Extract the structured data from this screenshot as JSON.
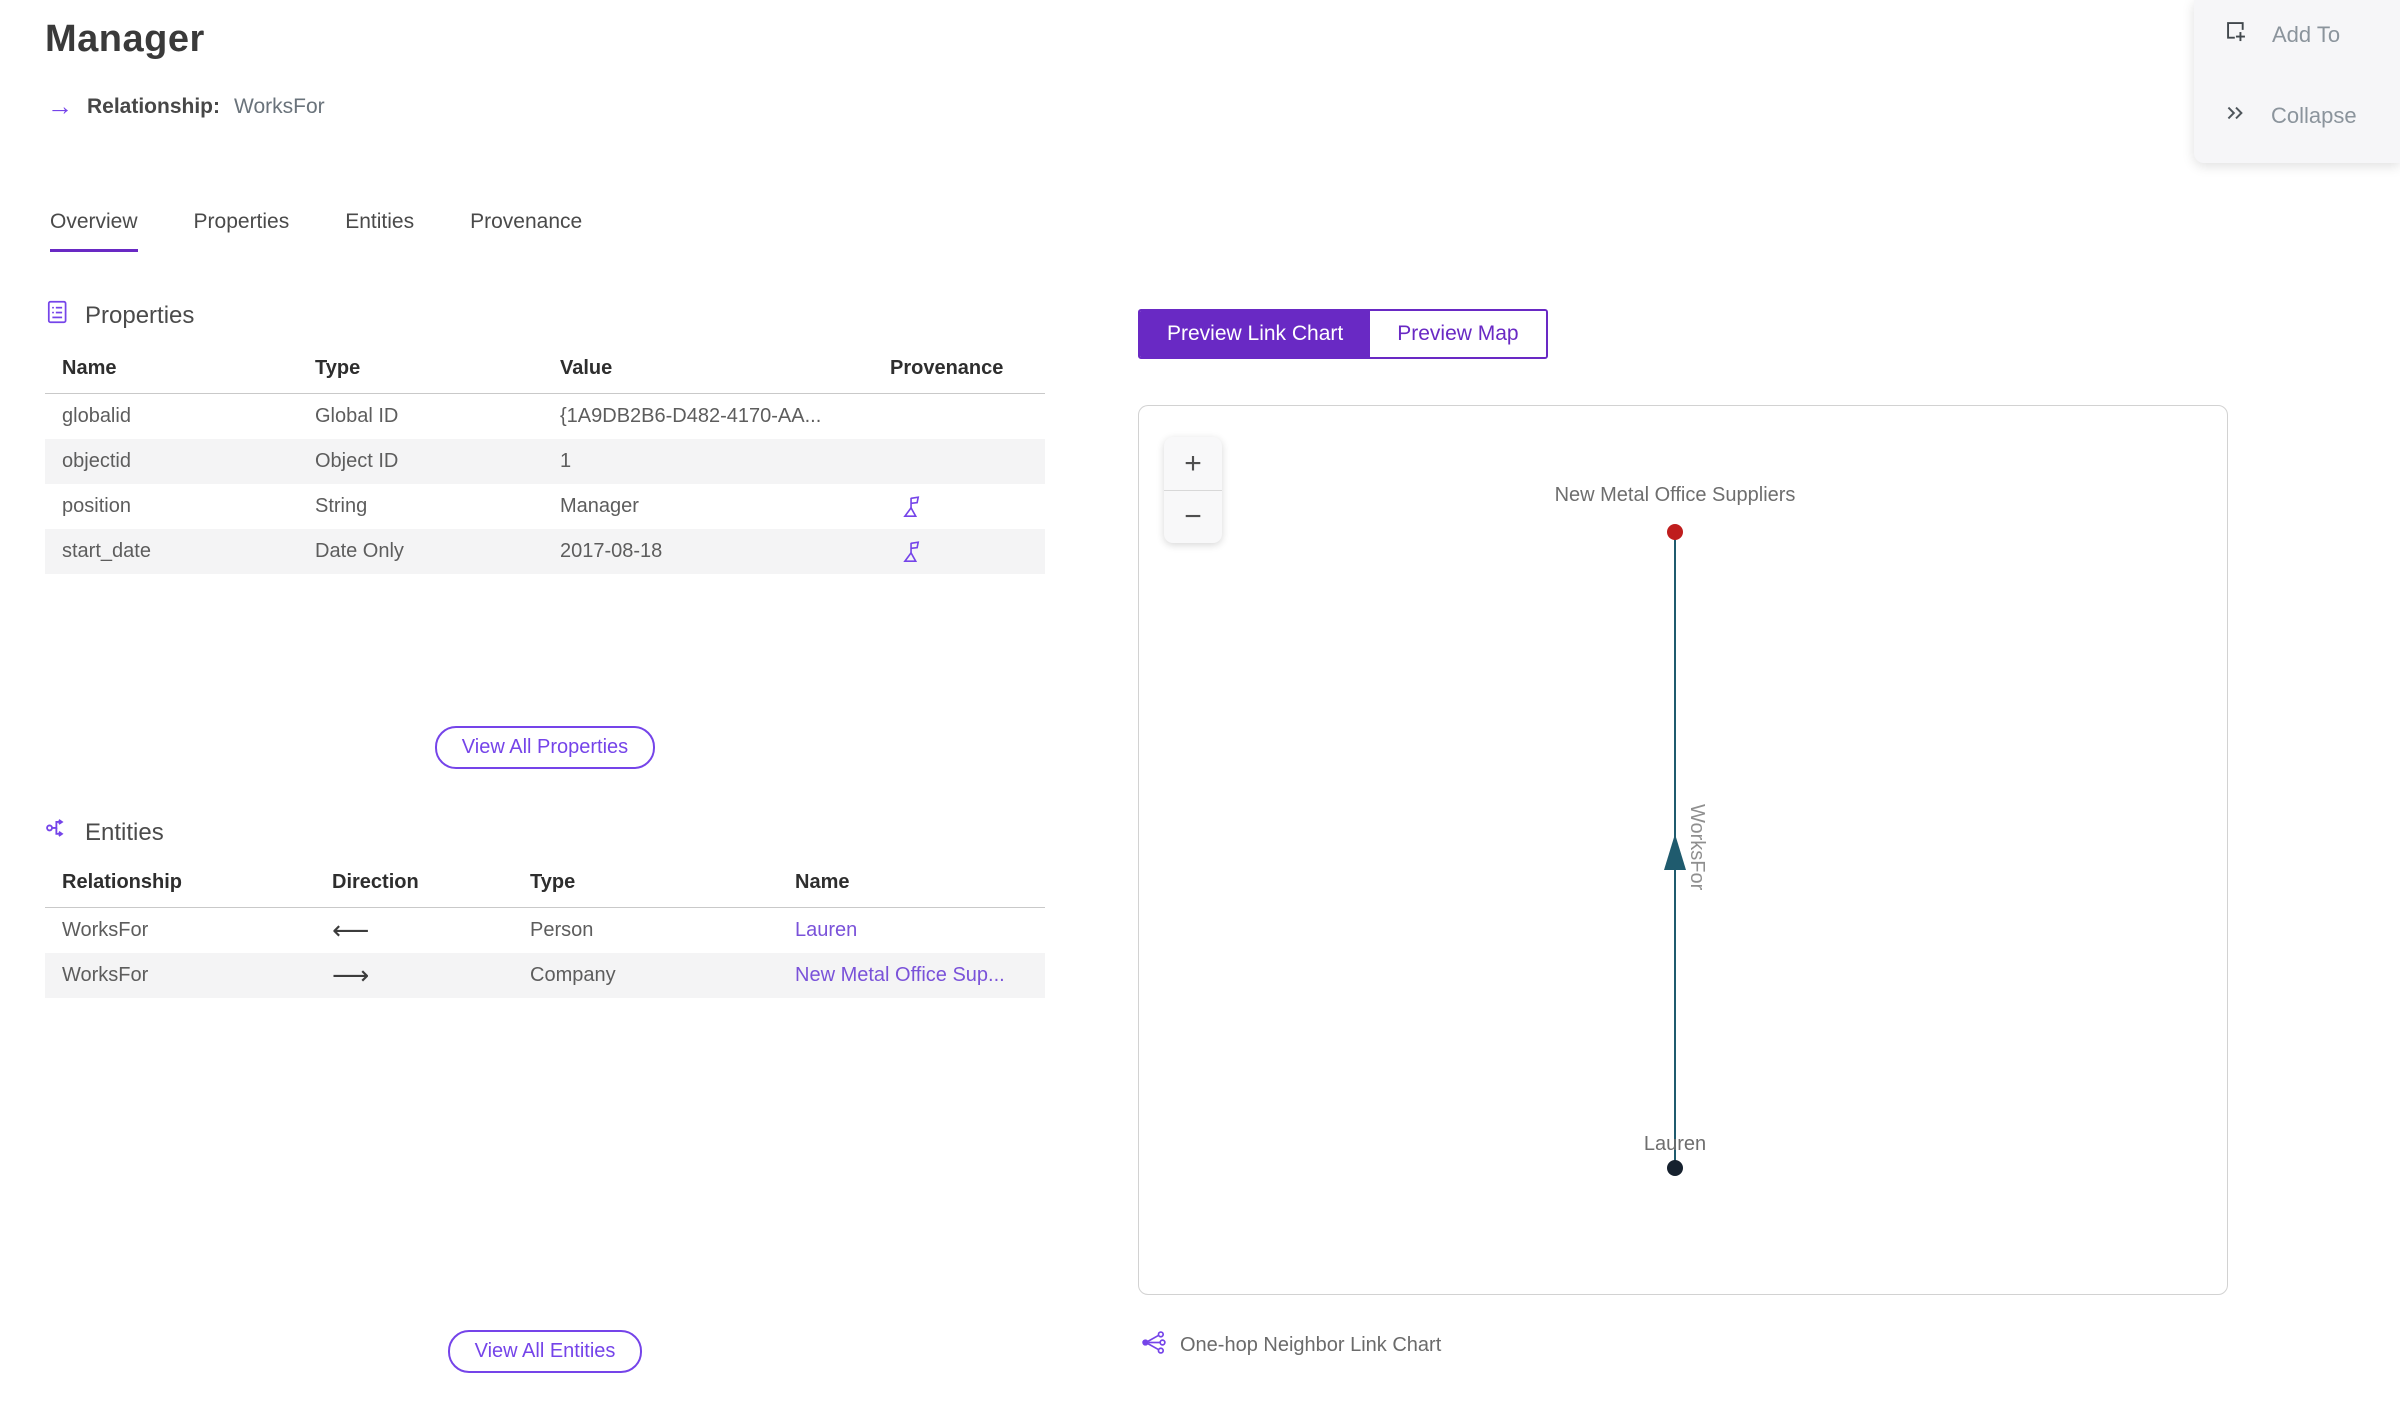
{
  "header": {
    "title": "Manager",
    "arrow_icon": "→",
    "subtitle_label": "Relationship:",
    "subtitle_value": "WorksFor"
  },
  "actions": {
    "add_to_label": "Add To",
    "collapse_label": "Collapse"
  },
  "tabs": {
    "overview": "Overview",
    "properties": "Properties",
    "entities": "Entities",
    "provenance": "Provenance",
    "active_tab": "Overview"
  },
  "properties_section": {
    "title": "Properties",
    "columns": {
      "name": "Name",
      "type": "Type",
      "value": "Value",
      "provenance": "Provenance"
    },
    "rows": [
      {
        "name": "globalid",
        "type": "Global ID",
        "value": "{1A9DB2B6-D482-4170-AA...",
        "provenance": false
      },
      {
        "name": "objectid",
        "type": "Object ID",
        "value": "1",
        "provenance": false
      },
      {
        "name": "position",
        "type": "String",
        "value": "Manager",
        "provenance": true
      },
      {
        "name": "start_date",
        "type": "Date Only",
        "value": "2017-08-18",
        "provenance": true
      }
    ],
    "view_all_label": "View All Properties"
  },
  "entities_section": {
    "title": "Entities",
    "columns": {
      "relationship": "Relationship",
      "direction": "Direction",
      "type": "Type",
      "name": "Name"
    },
    "rows": [
      {
        "relationship": "WorksFor",
        "direction": "⟵",
        "type": "Person",
        "name": "Lauren"
      },
      {
        "relationship": "WorksFor",
        "direction": "⟶",
        "type": "Company",
        "name": "New Metal Office Sup..."
      }
    ],
    "view_all_label": "View All Entities"
  },
  "preview": {
    "toggle_link_chart": "Preview Link Chart",
    "toggle_map": "Preview Map",
    "active_toggle": "Preview Link Chart",
    "zoom_in": "+",
    "zoom_out": "−",
    "caption": "One-hop Neighbor Link Chart"
  },
  "link_chart": {
    "nodes": [
      {
        "label": "New Metal Office Suppliers",
        "color": "#bf1d1d",
        "position": "top"
      },
      {
        "label": "Lauren",
        "color": "#16212e",
        "position": "bottom"
      }
    ],
    "edge": {
      "label": "WorksFor",
      "color": "#1f5b6e",
      "arrow_direction": "up"
    }
  },
  "colors": {
    "accent_purple": "#6929c4",
    "button_purple": "#7544e9",
    "link_purple": "#7a52d9",
    "icon_purple": "#7544e9",
    "edge_teal": "#1f5b6e",
    "node_red": "#bf1d1d",
    "node_dark": "#16212e",
    "panel_bg": "#f6f6f8"
  }
}
